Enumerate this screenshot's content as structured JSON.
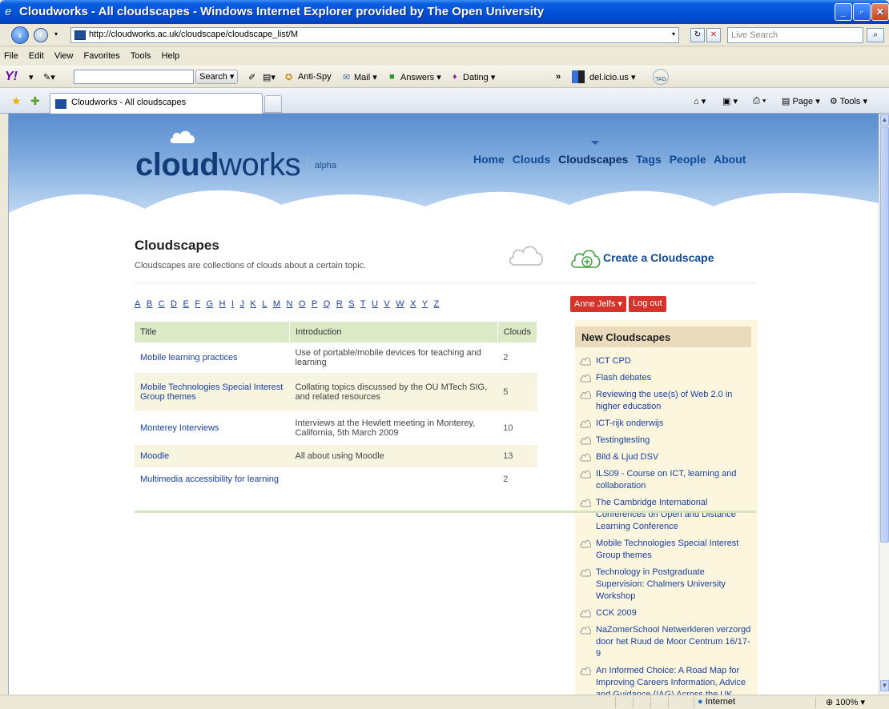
{
  "window": {
    "title": "Cloudworks - All cloudscapes - Windows Internet Explorer provided by The Open University"
  },
  "address": {
    "url": "http://cloudworks.ac.uk/cloudscape/cloudscape_list/M",
    "search_placeholder": "Live Search"
  },
  "menu": [
    "File",
    "Edit",
    "View",
    "Favorites",
    "Tools",
    "Help"
  ],
  "yahoo_toolbar": {
    "search_label": "Search",
    "antispy": "Anti-Spy",
    "mail": "Mail",
    "answers": "Answers",
    "dating": "Dating",
    "more": "»",
    "delicious": "del.icio.us",
    "tag": "TAG"
  },
  "tabs": {
    "active_label": "Cloudworks - All cloudscapes",
    "page_label": "Page",
    "tools_label": "Tools"
  },
  "site": {
    "logo_bold": "cloud",
    "logo_light": "works",
    "alpha": "alpha",
    "nav": [
      "Home",
      "Clouds",
      "Cloudscapes",
      "Tags",
      "People",
      "About"
    ],
    "active_nav": "Cloudscapes"
  },
  "page": {
    "title": "Cloudscapes",
    "subtitle": "Cloudscapes are collections of clouds about a certain topic.",
    "create_label": "Create a Cloudscape",
    "alphabet": [
      "A",
      "B",
      "C",
      "D",
      "E",
      "F",
      "G",
      "H",
      "I",
      "J",
      "K",
      "L",
      "M",
      "N",
      "O",
      "P",
      "Q",
      "R",
      "S",
      "T",
      "U",
      "V",
      "W",
      "X",
      "Y",
      "Z"
    ]
  },
  "user": {
    "name": "Anne Jelfs",
    "logout": "Log out"
  },
  "table": {
    "headers": [
      "Title",
      "Introduction",
      "Clouds"
    ],
    "rows": [
      {
        "title": "Mobile learning practices",
        "intro": "Use of portable/mobile devices for teaching and learning",
        "clouds": "2"
      },
      {
        "title": "Mobile Technologies Special Interest Group themes",
        "intro": "Collating topics discussed by the OU MTech SIG, and related resources",
        "clouds": "5"
      },
      {
        "title": "Monterey Interviews",
        "intro": "Interviews at the Hewlett meeting in Monterey, California, 5th March 2009",
        "clouds": "10"
      },
      {
        "title": "Moodle",
        "intro": "All about using Moodle",
        "clouds": "13"
      },
      {
        "title": "Multimedia accessibility for learning",
        "intro": "",
        "clouds": "2"
      }
    ]
  },
  "sidebar": {
    "heading": "New Cloudscapes",
    "items": [
      "ICT CPD",
      "Flash debates",
      "Reviewing the use(s) of Web 2.0 in higher education",
      "ICT-rijk onderwijs",
      "Testingtesting",
      "Bild & Ljud DSV",
      "ILS09 - Course on ICT, learning and collaboration",
      "The Cambridge International Conferences on Open and Distance Learning Conference",
      "Mobile Technologies Special Interest Group themes",
      "Technology in Postgraduate Supervision: Chalmers University Workshop",
      "CCK 2009",
      "NaZomerSchool Netwerkleren verzorgd door het Ruud de Moor Centrum 16/17-9",
      "An Informed Choice: A Road Map for Improving Careers Information, Advice and Guidance (IAG) Across the UK"
    ]
  },
  "status": {
    "zone": "Internet",
    "zoom": "100%"
  },
  "colors": {
    "link": "#1a3fa5",
    "nav": "#0f4b96",
    "button_red": "#d6332a",
    "table_header": "#dbe9c6",
    "sidebar_bg": "#fbf6dd"
  }
}
